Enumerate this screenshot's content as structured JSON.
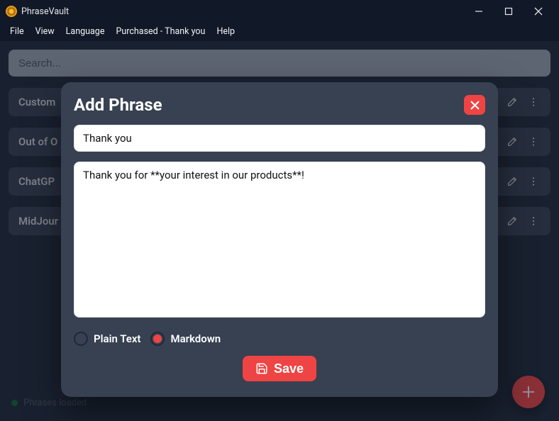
{
  "app": {
    "title": "PhraseVault"
  },
  "menu": {
    "file": "File",
    "view": "View",
    "language": "Language",
    "purchased": "Purchased - Thank you",
    "help": "Help"
  },
  "search": {
    "placeholder": "Search..."
  },
  "phrases": {
    "items": [
      {
        "title": "Custom"
      },
      {
        "title": "Out of O"
      },
      {
        "title": "ChatGP"
      },
      {
        "title": "MidJour"
      }
    ]
  },
  "modal": {
    "title": "Add Phrase",
    "phrase_title_value": "Thank you",
    "phrase_body_value": "Thank you for **your interest in our products**!",
    "format_plain": "Plain Text",
    "format_markdown": "Markdown",
    "format_selected": "markdown",
    "save_label": "Save"
  },
  "status": {
    "text": "Phrases loaded"
  },
  "colors": {
    "accent": "#ef4444",
    "bg": "#1f2937",
    "panel": "#374151",
    "titlebar": "#111827"
  }
}
